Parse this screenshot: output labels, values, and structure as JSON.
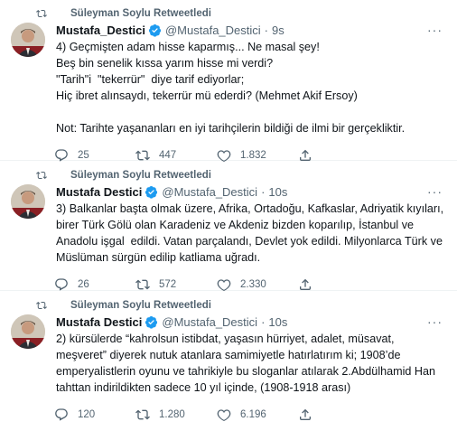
{
  "tweets": [
    {
      "retweeted_by": "Süleyman Soylu Retweetledi",
      "name": "Mustafa_Destici",
      "handle": "@Mustafa_Destici",
      "separator": "·",
      "time": "9s",
      "text": "4) Geçmişten adam hisse kaparmış... Ne masal şey!\nBeş bin senelik kıssa yarım hisse mi verdi?\n\"Tarih\"i  \"tekerrür\"  diye tarif ediyorlar;\nHiç ibret alınsaydı, tekerrür mü ederdi? (Mehmet Akif Ersoy)\n\nNot: Tarihte yaşananları en iyi tarihçilerin bildiği de ilmi bir gerçekliktir.",
      "replies": "25",
      "retweets": "447",
      "likes": "1.832"
    },
    {
      "retweeted_by": "Süleyman Soylu Retweetledi",
      "name": "Mustafa Destici",
      "handle": "@Mustafa_Destici",
      "separator": "·",
      "time": "10s",
      "text": "3) Balkanlar başta olmak üzere, Afrika, Ortadoğu, Kafkaslar, Adriyatik kıyıları, birer Türk Gölü olan Karadeniz ve Akdeniz bizden koparılıp, İstanbul ve Anadolu işgal  edildi. Vatan parçalandı, Devlet yok edildi. Milyonlarca Türk ve Müslüman sürgün edilip katliama uğradı.",
      "replies": "26",
      "retweets": "572",
      "likes": "2.330"
    },
    {
      "retweeted_by": "Süleyman Soylu Retweetledi",
      "name": "Mustafa Destici",
      "handle": "@Mustafa_Destici",
      "separator": "·",
      "time": "10s",
      "text": "2) kürsülerde “kahrolsun istibdat, yaşasın hürriyet, adalet, müsavat, meşveret” diyerek nutuk atanlara samimiyetle hatırlatırım ki; 1908’de emperyalistlerin oyunu ve tahrikiyle bu sloganlar atılarak 2.Abdülhamid Han tahttan indirildikten sadece 10 yıl içinde, (1908-1918 arası)",
      "replies": "120",
      "retweets": "1.280",
      "likes": "6.196"
    }
  ],
  "colors": {
    "verified": "#1d9bf0",
    "muted": "#536471",
    "text": "#0f1419",
    "divider": "#eff3f4"
  },
  "icons": {
    "retweet": "retweet-icon",
    "verified": "verified-badge-icon",
    "reply": "reply-icon",
    "like": "heart-icon",
    "share": "share-icon",
    "more": "more-icon"
  }
}
